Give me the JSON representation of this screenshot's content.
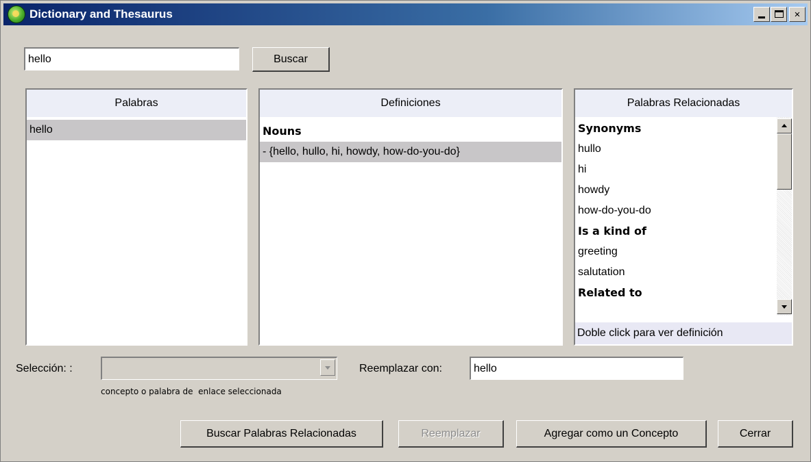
{
  "window": {
    "title": "Dictionary and Thesaurus",
    "controls": {
      "minimize": "_",
      "maximize": "□",
      "close": "✕"
    }
  },
  "search": {
    "value": "hello",
    "button": "Buscar"
  },
  "palabras": {
    "header": "Palabras",
    "items": [
      {
        "text": "hello",
        "selected": true
      }
    ]
  },
  "definiciones": {
    "header": "Definiciones",
    "section": "Nouns",
    "items": [
      {
        "text": "- {hello, hullo, hi, howdy, how-do-you-do}",
        "selected": true
      }
    ]
  },
  "relacionadas": {
    "header": "Palabras Relacionadas",
    "rows": [
      {
        "text": "Synonyms",
        "bold": true
      },
      {
        "text": "hullo"
      },
      {
        "text": "hi"
      },
      {
        "text": "howdy"
      },
      {
        "text": "how-do-you-do"
      },
      {
        "text": "Is a kind of",
        "bold": true
      },
      {
        "text": "greeting"
      },
      {
        "text": "salutation"
      },
      {
        "text": "Related to",
        "bold": true
      }
    ],
    "footer": "Doble click para ver definición"
  },
  "seleccion": {
    "label": "Selección: :",
    "value": "",
    "hint": "concepto o palabra de  enlace seleccionada"
  },
  "reemplazar": {
    "label": "Reemplazar con:",
    "value": "hello"
  },
  "buttons": {
    "buscar_relacionadas": "Buscar Palabras Relacionadas",
    "reemplazar": "Reemplazar",
    "agregar": "Agregar como un Concepto",
    "cerrar": "Cerrar"
  }
}
